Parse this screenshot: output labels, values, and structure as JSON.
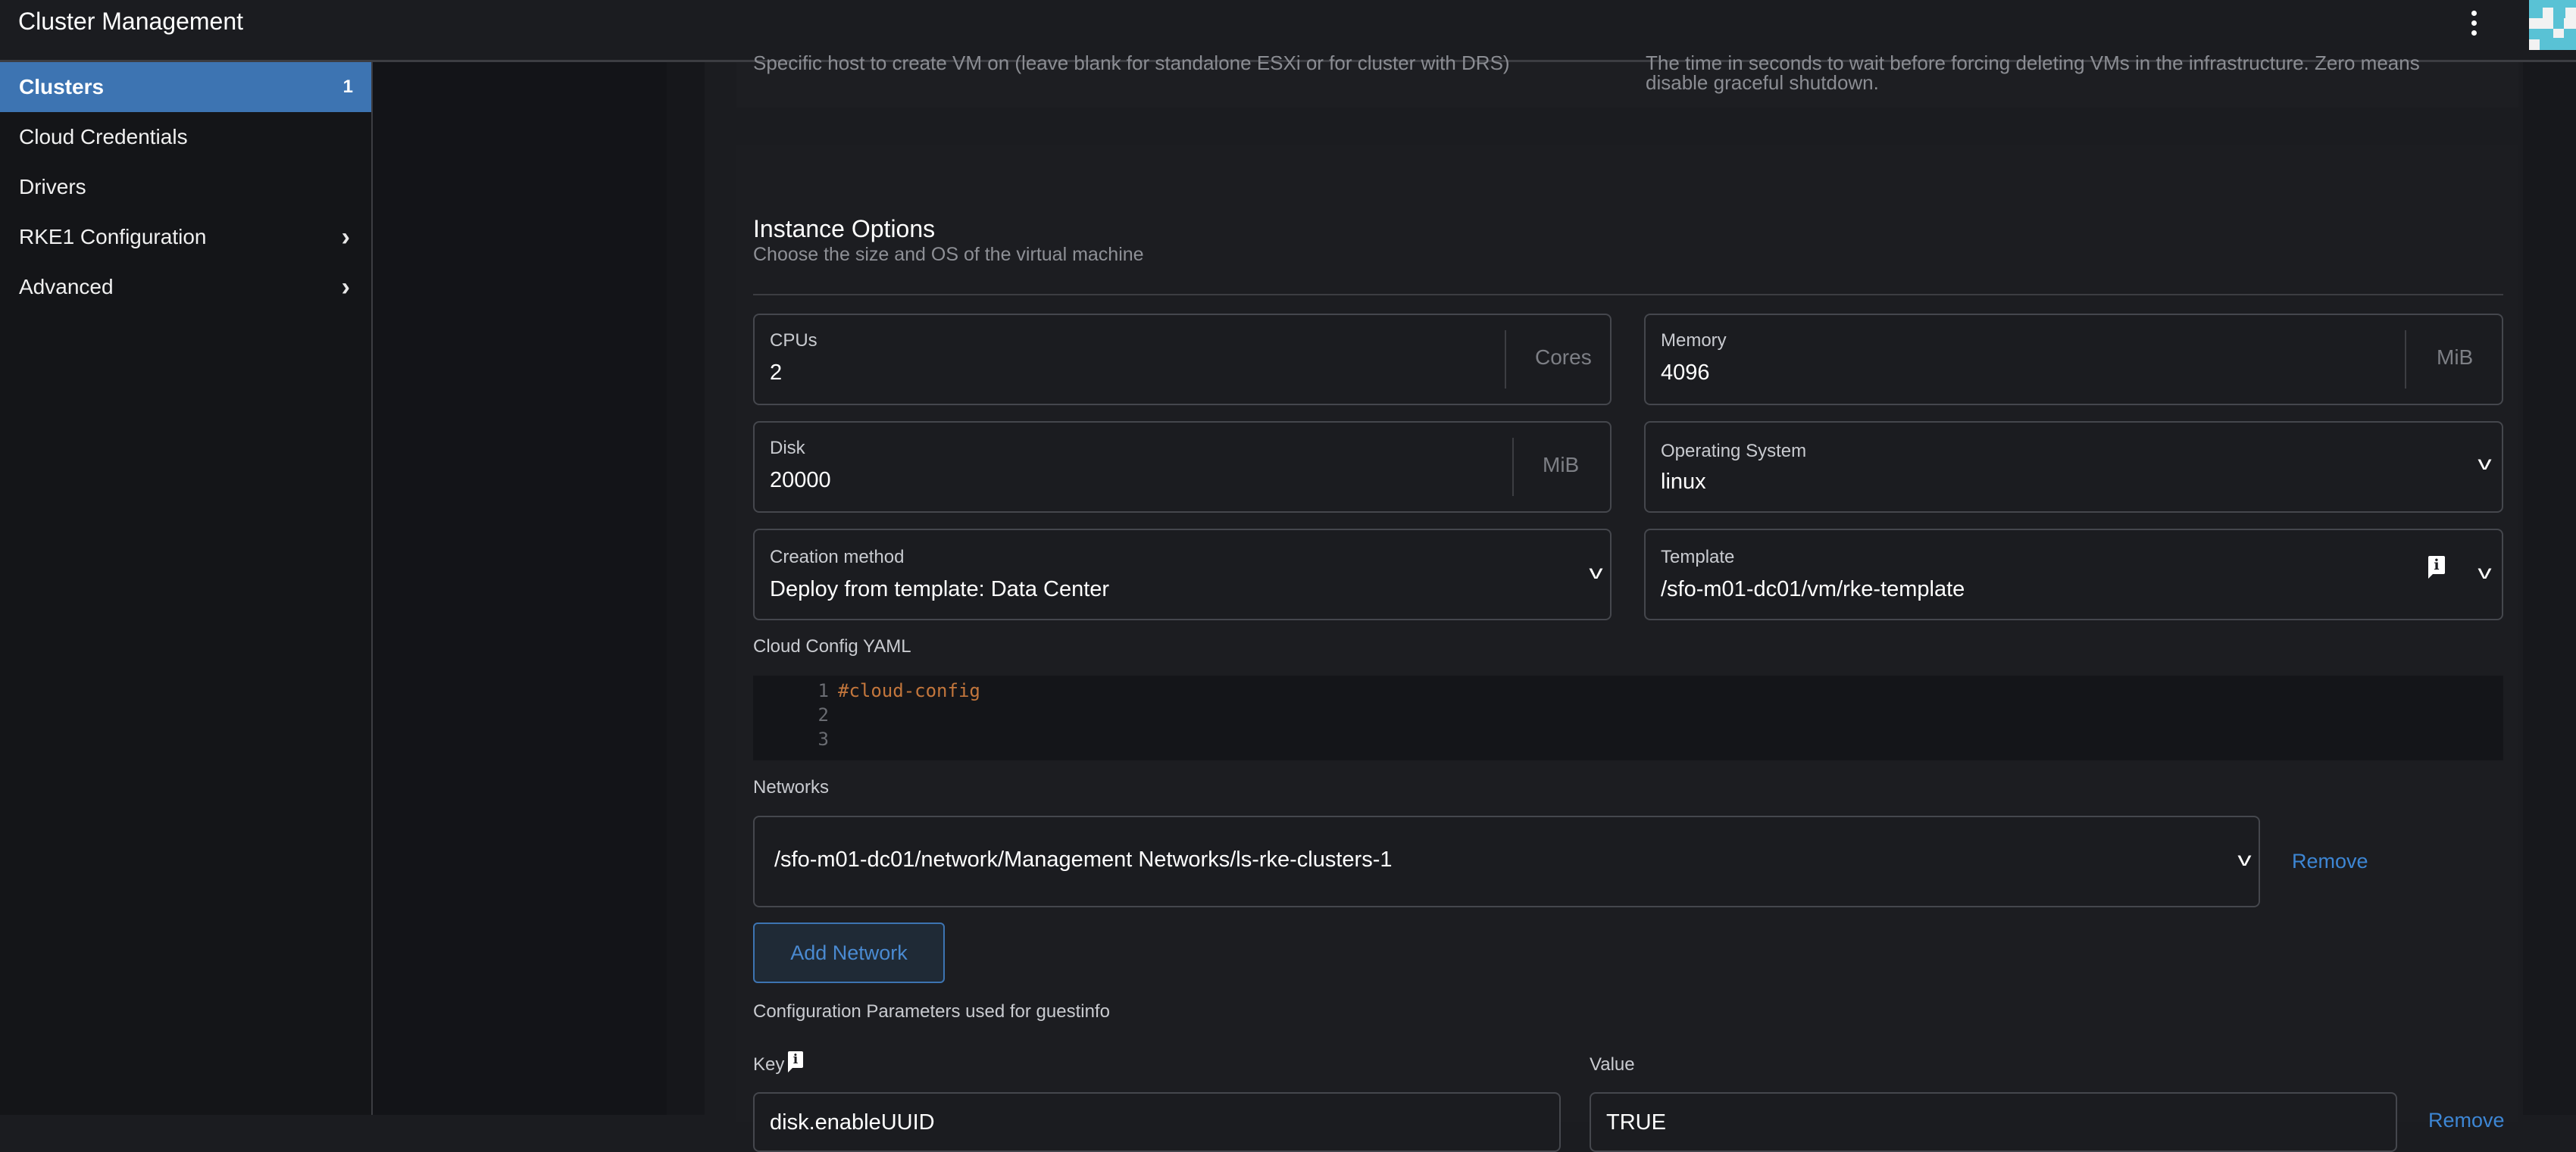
{
  "header": {
    "title": "Cluster Management",
    "menu_icon": "kebab-menu-icon",
    "avatar_icon": "user-avatar-identicon"
  },
  "sidebar": {
    "items": [
      {
        "label": "Clusters",
        "count": "1",
        "active": true
      },
      {
        "label": "Cloud Credentials"
      },
      {
        "label": "Drivers"
      },
      {
        "label": "RKE1 Configuration",
        "chevron": "›"
      },
      {
        "label": "Advanced",
        "chevron": "›"
      }
    ]
  },
  "previous_section": {
    "host_help": "Specific host to create VM on (leave blank for standalone ESXi or for cluster with DRS)",
    "graceful_help_line1": "The time in seconds to wait before forcing deleting VMs in the infrastructure. Zero means",
    "graceful_help_line2": "disable graceful shutdown."
  },
  "instance_options": {
    "title": "Instance Options",
    "subtitle": "Choose the size and OS of the virtual machine",
    "cpus": {
      "label": "CPUs",
      "value": "2",
      "suffix": "Cores"
    },
    "memory": {
      "label": "Memory",
      "value": "4096",
      "suffix": "MiB"
    },
    "disk": {
      "label": "Disk",
      "value": "20000",
      "suffix": "MiB"
    },
    "os": {
      "label": "Operating System",
      "value": "linux"
    },
    "creation_method": {
      "label": "Creation method",
      "value": "Deploy from template: Data Center"
    },
    "template": {
      "label": "Template",
      "value": "/sfo-m01-dc01/vm/rke-template",
      "info_icon": "i"
    },
    "chevron_glyph": "v",
    "cloud_config": {
      "label": "Cloud Config YAML",
      "lines": [
        {
          "num": "1",
          "text": "#cloud-config"
        },
        {
          "num": "2",
          "text": ""
        },
        {
          "num": "3",
          "text": ""
        }
      ]
    },
    "networks": {
      "label": "Networks",
      "items": [
        {
          "value": "/sfo-m01-dc01/network/Management Networks/ls-rke-clusters-1"
        }
      ],
      "remove_label": "Remove",
      "add_label": "Add Network"
    },
    "guestinfo": {
      "label": "Configuration Parameters used for guestinfo",
      "key_header": "Key",
      "value_header": "Value",
      "info_icon": "i",
      "rows": [
        {
          "key": "disk.enableUUID",
          "value": "TRUE"
        }
      ],
      "remove_label": "Remove"
    }
  },
  "colors": {
    "accent": "#3d74b2",
    "link": "#3d86d4",
    "background": "#1b1c20",
    "code_comment": "#c3763c"
  }
}
